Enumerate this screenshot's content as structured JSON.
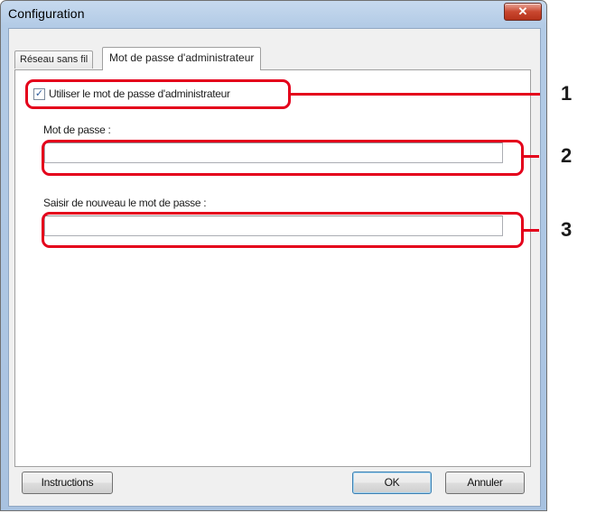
{
  "window": {
    "title": "Configuration",
    "close_symbol": "✕"
  },
  "tabs": [
    {
      "label": "Réseau sans fil",
      "active": false
    },
    {
      "label": "Mot de passe d'administrateur",
      "active": true
    }
  ],
  "admin_password": {
    "use_checkbox_label": "Utiliser le mot de passe d'administrateur",
    "use_checked": true,
    "password_label": "Mot de passe :",
    "password_value": "",
    "confirm_label": "Saisir de nouveau le mot de passe :",
    "confirm_value": ""
  },
  "buttons": {
    "instructions": "Instructions",
    "ok": "OK",
    "cancel": "Annuler"
  },
  "callouts": [
    "1",
    "2",
    "3"
  ],
  "colors": {
    "callout": "#e4001b",
    "titlebar": "#b3cbe6",
    "close_button": "#c9472f"
  }
}
